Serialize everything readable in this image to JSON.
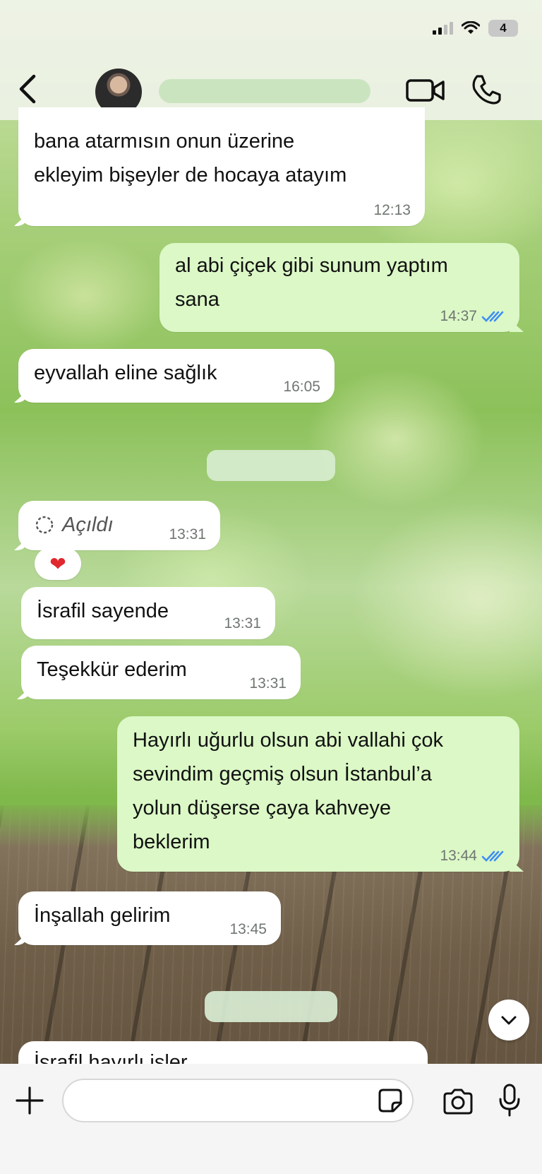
{
  "header": {
    "contact_name": "",
    "battery": "4"
  },
  "messages": [
    {
      "text": "bana atarmısın onun üzerine\nekleyim bişeyler de hocaya atayım",
      "time": "12:13"
    },
    {
      "text": "al abi çiçek gibi sunum yaptım\nsana",
      "time": "14:37"
    },
    {
      "text": "eyvallah eline sağlık",
      "time": "16:05"
    },
    {
      "text": "Açıldı",
      "time": "13:31"
    },
    {
      "text": "İsrafil sayende",
      "time": "13:31"
    },
    {
      "text": "Teşekkür ederim",
      "time": "13:31"
    },
    {
      "text": "Hayırlı uğurlu olsun abi vallahi çok\nsevindim geçmiş olsun İstanbul’a\nyolun düşerse çaya kahveye\nbeklerim",
      "time": "13:44"
    },
    {
      "text": "İnşallah gelirim",
      "time": "13:45"
    },
    {
      "text": "İsrafil hayırlı işler"
    }
  ],
  "reaction": "❤",
  "colors": {
    "outgoing_bubble": "#dbf8c6",
    "incoming_bubble": "#ffffff",
    "read_ticks": "#3d8df5"
  },
  "input": {
    "placeholder": ""
  },
  "icons": [
    "back-icon",
    "video-call-icon",
    "phone-icon",
    "read-ticks-icon",
    "view-once-icon",
    "chevron-down-icon",
    "plus-icon",
    "sticker-icon",
    "camera-icon",
    "mic-icon"
  ]
}
